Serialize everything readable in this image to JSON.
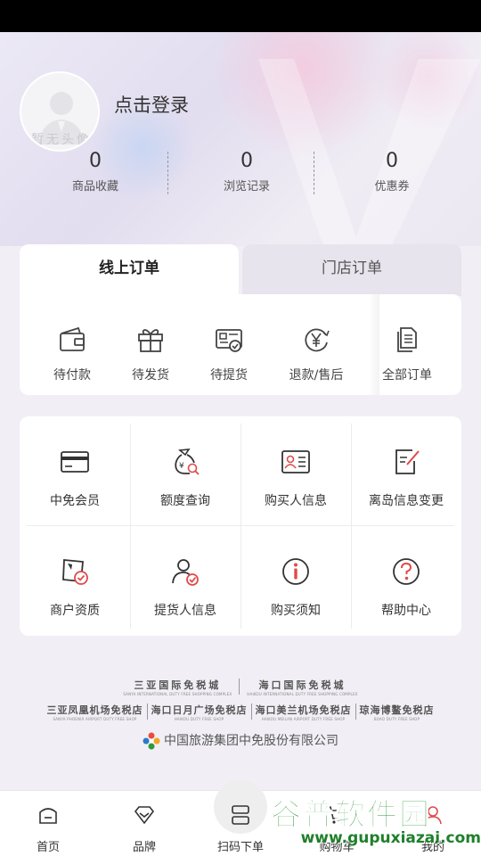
{
  "profile": {
    "avatar_label": "暂无头像",
    "login_text": "点击登录"
  },
  "stats": [
    {
      "value": "0",
      "label": "商品收藏"
    },
    {
      "value": "0",
      "label": "浏览记录"
    },
    {
      "value": "0",
      "label": "优惠券"
    }
  ],
  "tabs": {
    "online": "线上订单",
    "store": "门店订单"
  },
  "orders": [
    {
      "label": "待付款",
      "icon": "wallet-icon"
    },
    {
      "label": "待发货",
      "icon": "gift-icon"
    },
    {
      "label": "待提货",
      "icon": "pickup-card-icon"
    },
    {
      "label": "退款/售后",
      "icon": "yen-refund-icon"
    },
    {
      "label": "全部订单",
      "icon": "documents-icon"
    }
  ],
  "services": [
    {
      "label": "中免会员",
      "icon": "card-icon"
    },
    {
      "label": "额度查询",
      "icon": "money-bag-search-icon"
    },
    {
      "label": "购买人信息",
      "icon": "id-card-icon"
    },
    {
      "label": "离岛信息变更",
      "icon": "edit-document-icon"
    },
    {
      "label": "商户资质",
      "icon": "certificate-icon"
    },
    {
      "label": "提货人信息",
      "icon": "user-check-icon"
    },
    {
      "label": "购买须知",
      "icon": "info-icon"
    },
    {
      "label": "帮助中心",
      "icon": "question-icon"
    }
  ],
  "brands": {
    "row1": [
      {
        "cn": "三亚国际免税城",
        "en": "SANYA INTERNATIONAL DUTY FREE SHOPPING COMPLEX"
      },
      {
        "cn": "海口国际免税城",
        "en": "HAIKOU INTERNATIONAL DUTY FREE SHOPPING COMPLEX"
      }
    ],
    "row2": [
      {
        "cn": "三亚凤凰机场免税店",
        "en": "SANYA PHOENIX AIRPORT DUTY FREE SHOP"
      },
      {
        "cn": "海口日月广场免税店",
        "en": "HAIKOU DUTY FREE SHOP"
      },
      {
        "cn": "海口美兰机场免税店",
        "en": "HAIKOU MEILAN AIRPORT DUTY FREE SHOP"
      },
      {
        "cn": "琼海博鳌免税店",
        "en": "BOAO DUTY FREE SHOP"
      }
    ],
    "company": "中国旅游集团中免股份有限公司"
  },
  "nav": [
    {
      "label": "首页",
      "icon": "home-icon"
    },
    {
      "label": "品牌",
      "icon": "diamond-icon"
    },
    {
      "label": "扫码下单",
      "icon": "scan-icon"
    },
    {
      "label": "购物车",
      "icon": "cart-icon"
    },
    {
      "label": "我的",
      "icon": "user-icon"
    }
  ],
  "watermark": {
    "title": "谷普软件园",
    "url": "www.gupuxiazai.com"
  },
  "colors": {
    "hero_bg": "#e6e2f1",
    "card_bg": "#ffffff",
    "accent_red": "#e04a4a",
    "watermark_green": "#2e9a3a"
  }
}
